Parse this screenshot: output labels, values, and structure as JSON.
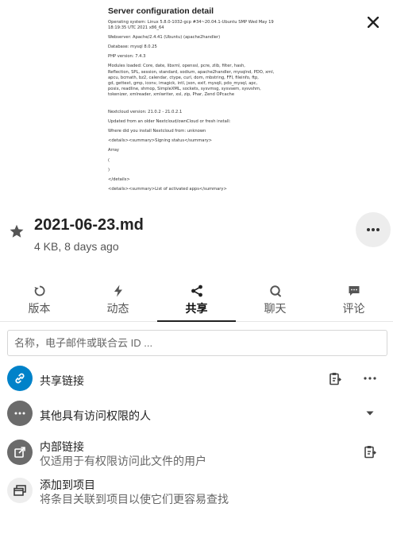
{
  "preview": {
    "title": "Server configuration detail",
    "lines": [
      "Operating system: Linux 5.8.0-1032-gcp #34~20.04.1-Ubuntu SMP Wed May 19",
      "18:19:35 UTC 2021 x86_64",
      "",
      "Webserver: Apache/2.4.41 (Ubuntu) (apache2handler)",
      "",
      "Database: mysql 8.0.25",
      "",
      "PHP version: 7.4.3",
      "",
      "Modules loaded: Core, date, libxml, openssl, pcre, zlib, filter, hash,",
      "Reflection, SPL, session, standard, sodium, apache2handler, mysqlnd, PDO, xml,",
      "apcu, bcmath, bz2, calendar, ctype, curl, dom, mbstring, FFI, fileinfo, ftp,",
      "gd, gettext, gmp, iconv, imagick, intl, json, exif, mysqli, pdo_mysql, apc,",
      "posix, readline, shmop, SimpleXML, sockets, sysvmsg, sysvsem, sysvshm,",
      "tokenizer, xmlreader, xmlwriter, xsl, zip, Phar, Zend OPcache",
      "",
      "",
      "",
      "Nextcloud version: 21.0.2 - 21.0.2.1",
      "",
      "Updated from an older Nextcloud/ownCloud or fresh install:",
      "",
      "Where did you install Nextcloud from: unknown",
      "",
      "<details><summary>Signing status</summary>",
      "",
      "Array",
      "",
      "(",
      "",
      ")",
      "",
      "</details>",
      "",
      "<details><summary>List of activated apps</summary>"
    ]
  },
  "file": {
    "name": "2021-06-23.md",
    "meta": "4 KB, 8 days ago"
  },
  "tabs": [
    {
      "label": "版本",
      "icon": "history-icon"
    },
    {
      "label": "动态",
      "icon": "activity-bolt-icon"
    },
    {
      "label": "共享",
      "icon": "share-icon"
    },
    {
      "label": "聊天",
      "icon": "chat-icon"
    },
    {
      "label": "评论",
      "icon": "comment-icon"
    }
  ],
  "active_tab": "共享",
  "search": {
    "placeholder": "名称，电子邮件或联合云 ID ..."
  },
  "share_link": {
    "label": "共享链接"
  },
  "others_access": {
    "label": "其他具有访问权限的人"
  },
  "internal_link": {
    "label": "内部链接",
    "description": "仅适用于有权限访问此文件的用户"
  },
  "add_project": {
    "label": "添加到项目",
    "description": "将条目关联到项目以使它们更容易查找"
  },
  "colors": {
    "accent": "#0082c9",
    "muted_circle": "#6b6b6b"
  }
}
